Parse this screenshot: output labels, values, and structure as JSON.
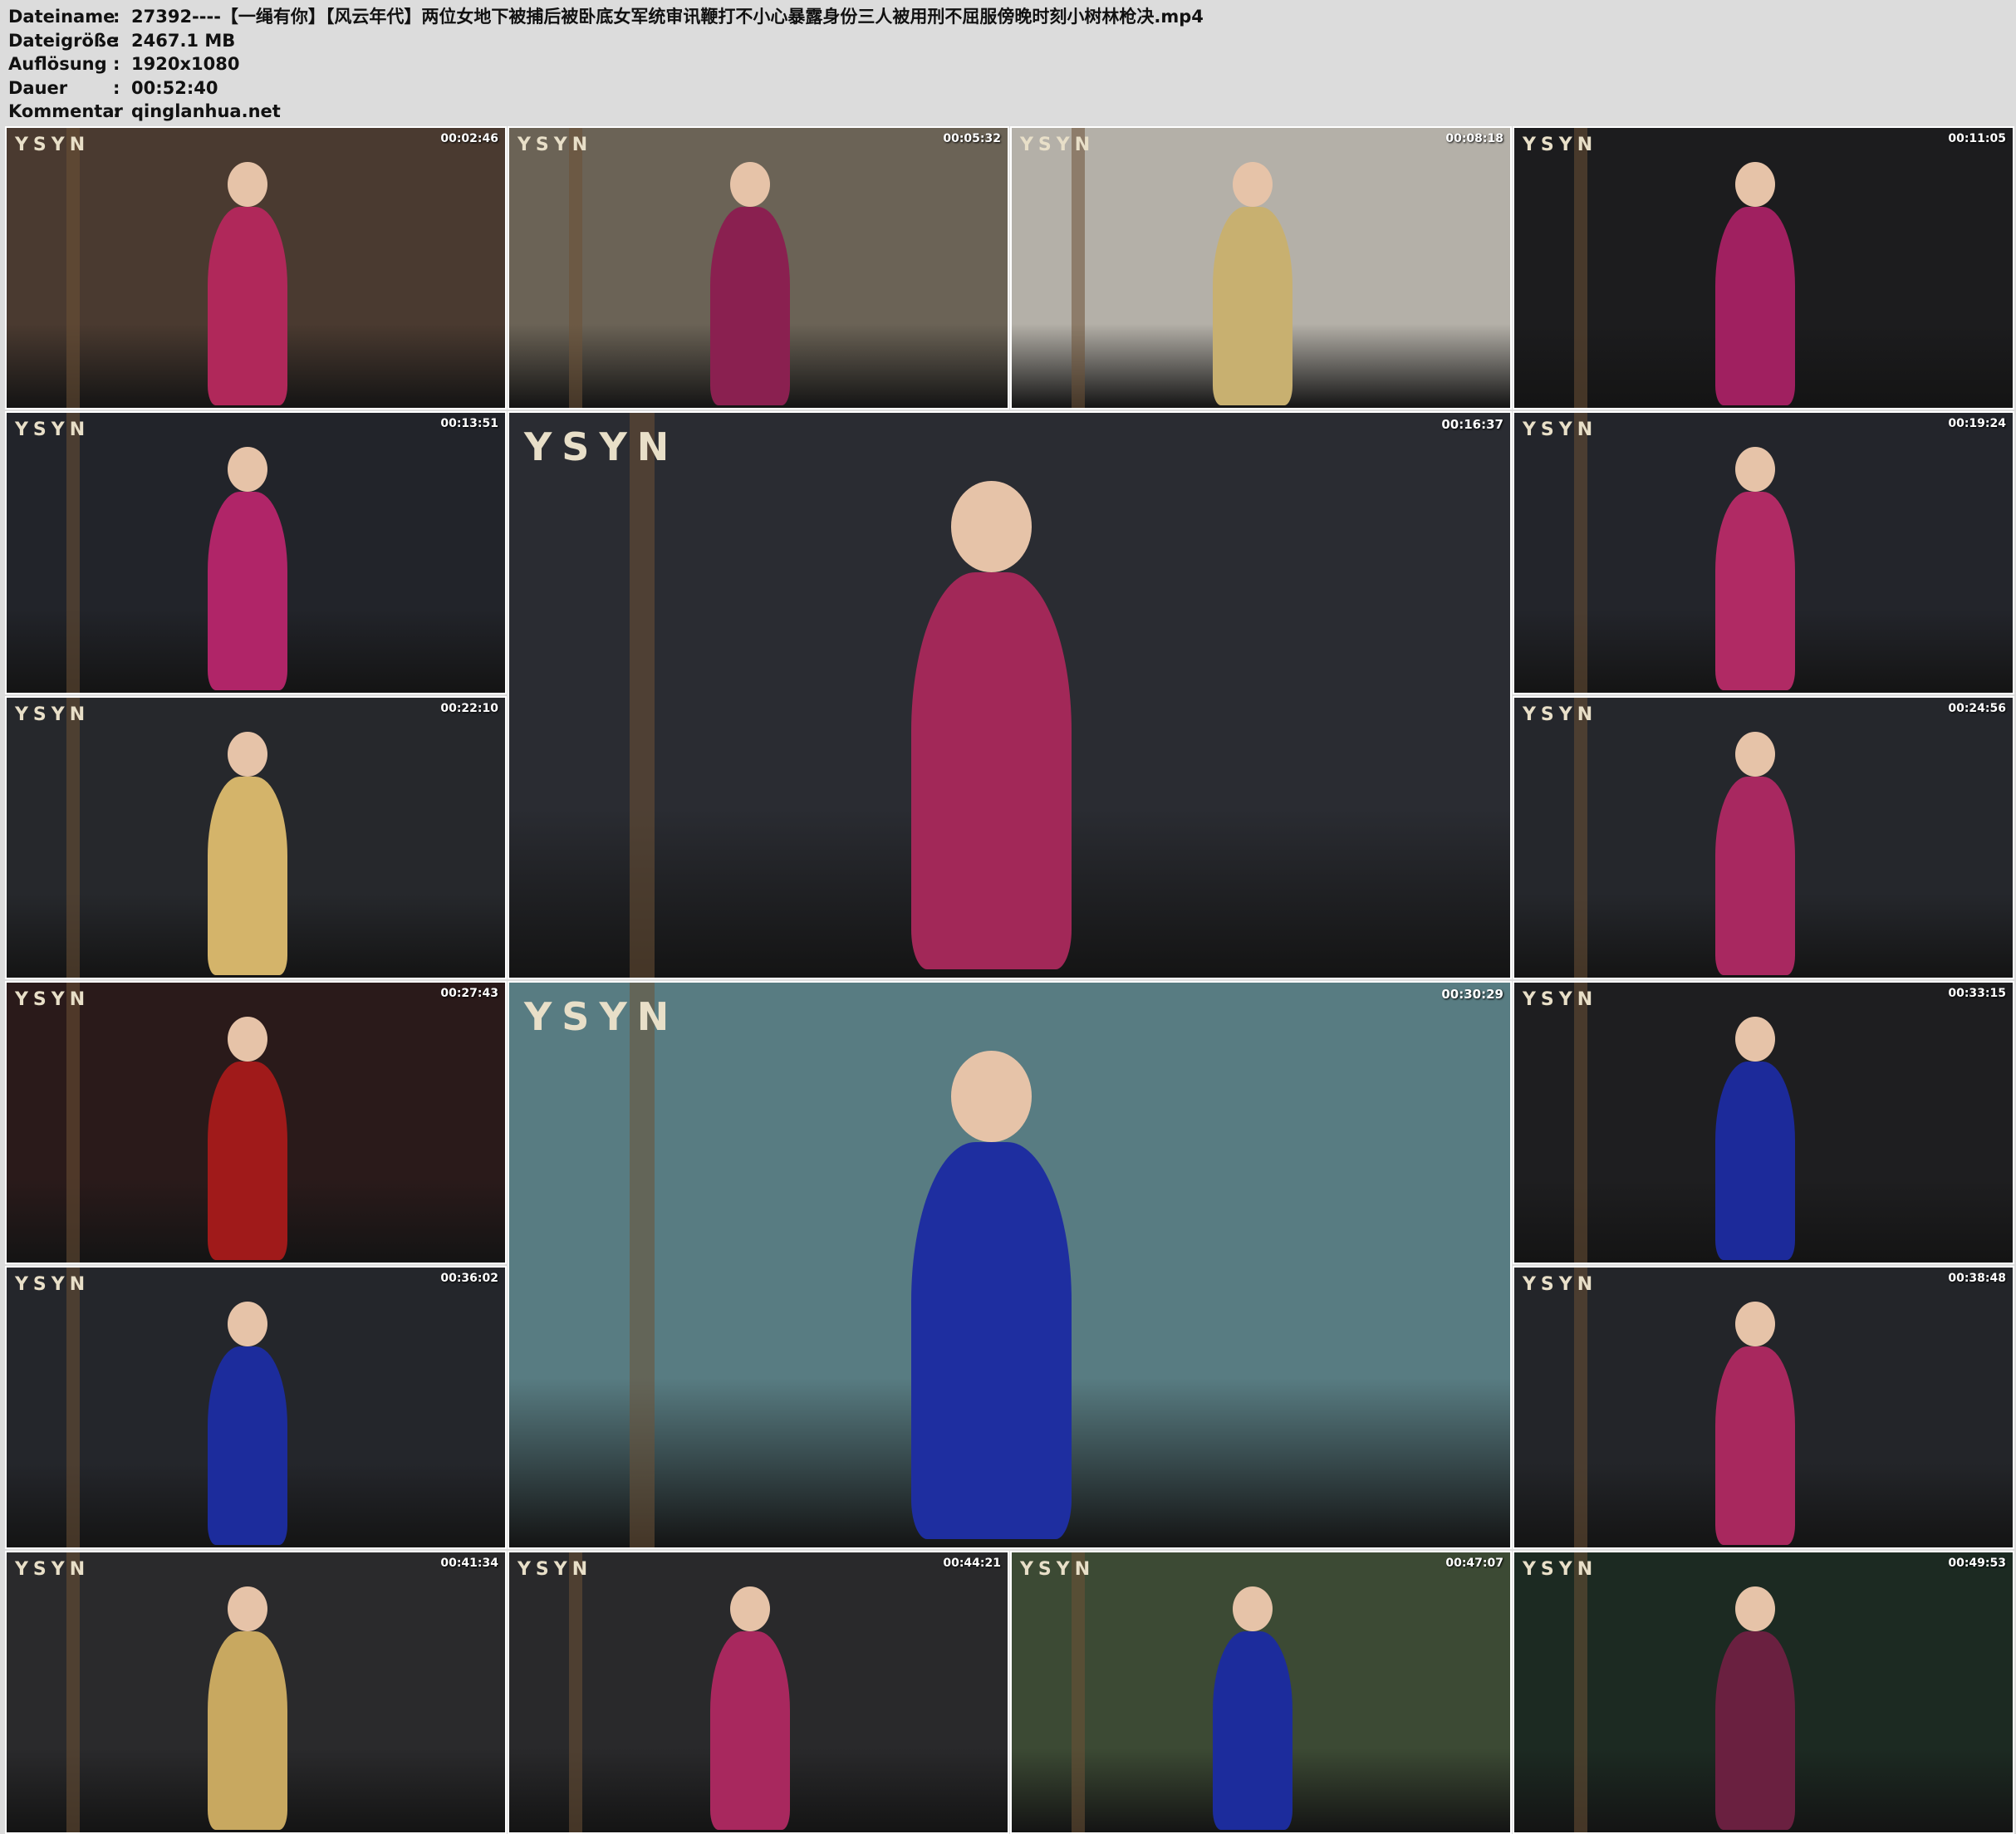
{
  "header": {
    "rows": [
      {
        "label": "Dateiname",
        "sep": ":",
        "value": "27392----【一绳有你】【风云年代】两位女地下被捕后被卧底女军统审讯鞭打不小心暴露身份三人被用刑不屈服傍晚时刻小树林枪决.mp4"
      },
      {
        "label": "Dateigröße",
        "sep": ":",
        "value": "2467.1 MB"
      },
      {
        "label": "Auflösung",
        "sep": ":",
        "value": "1920x1080"
      },
      {
        "label": "Dauer",
        "sep": ":",
        "value": "00:52:40"
      },
      {
        "label": "Kommentar",
        "sep": ":",
        "value": "qinglanhua.net"
      }
    ]
  },
  "logo_text": "YSYN",
  "thumbnails": [
    {
      "time": "00:02:46",
      "bg": "#4a3a30",
      "accent": "#b0285a"
    },
    {
      "time": "00:05:32",
      "bg": "#6b6356",
      "accent": "#8a2050"
    },
    {
      "time": "00:08:18",
      "bg": "#b4b0a8",
      "accent": "#c8b070"
    },
    {
      "time": "00:11:05",
      "bg": "#1c1c1e",
      "accent": "#a02060"
    },
    {
      "time": "00:13:51",
      "bg": "#22242a",
      "accent": "#b02568"
    },
    {
      "time": "00:16:37",
      "bg": "#2a2c32",
      "accent": "#a22858"
    },
    {
      "time": "00:19:24",
      "bg": "#23252b",
      "accent": "#b02a64"
    },
    {
      "time": "00:22:10",
      "bg": "#26282c",
      "accent": "#d4b46a"
    },
    {
      "time": "00:24:56",
      "bg": "#25272c",
      "accent": "#a82860"
    },
    {
      "time": "00:27:43",
      "bg": "#2a1a1a",
      "accent": "#a01a1a"
    },
    {
      "time": "00:30:29",
      "bg": "#587c82",
      "accent": "#1e2ea0"
    },
    {
      "time": "00:33:15",
      "bg": "#1e1e20",
      "accent": "#1c2a9a"
    },
    {
      "time": "00:36:02",
      "bg": "#24262b",
      "accent": "#1c2c9c"
    },
    {
      "time": "00:38:48",
      "bg": "#232529",
      "accent": "#a8285e"
    },
    {
      "time": "00:41:34",
      "bg": "#2a2a2c",
      "accent": "#c8a860"
    },
    {
      "time": "00:44:21",
      "bg": "#29292b",
      "accent": "#a8285e"
    },
    {
      "time": "00:47:07",
      "bg": "#3c4a34",
      "accent": "#1c2c9c"
    },
    {
      "time": "00:49:53",
      "bg": "#1c2a22",
      "accent": "#6a2040"
    }
  ]
}
